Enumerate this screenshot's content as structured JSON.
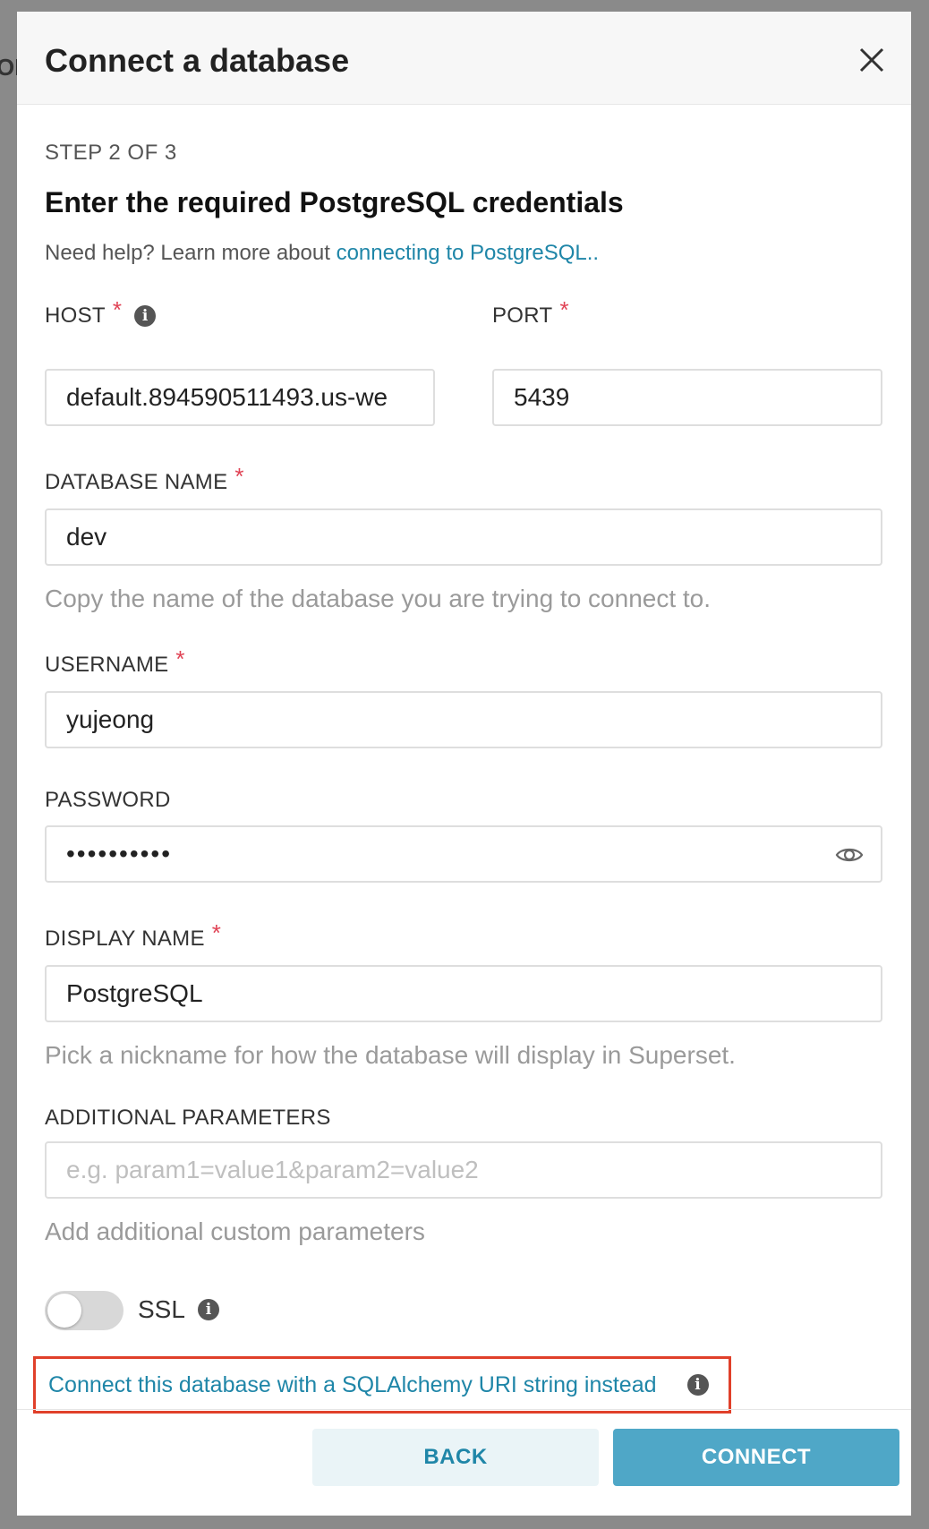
{
  "backdrop": {
    "text": "ON"
  },
  "modal": {
    "title": "Connect a database",
    "step": "STEP 2 OF 3",
    "heading": "Enter the required PostgreSQL credentials",
    "help_prefix": "Need help? Learn more about ",
    "help_link": "connecting to PostgreSQL.."
  },
  "form": {
    "host": {
      "label": "HOST",
      "required": "*",
      "value": "default.894590511493.us-we"
    },
    "port": {
      "label": "PORT",
      "required": "*",
      "value": "5439"
    },
    "database_name": {
      "label": "DATABASE NAME",
      "required": "*",
      "value": "dev",
      "hint": "Copy the name of the database you are trying to connect to."
    },
    "username": {
      "label": "USERNAME",
      "required": "*",
      "value": "yujeong"
    },
    "password": {
      "label": "PASSWORD",
      "value": "••••••••••"
    },
    "display_name": {
      "label": "DISPLAY NAME",
      "required": "*",
      "value": "PostgreSQL",
      "hint": "Pick a nickname for how the database will display in Superset."
    },
    "additional_parameters": {
      "label": "ADDITIONAL PARAMETERS",
      "placeholder": "e.g. param1=value1&param2=value2",
      "hint": "Add additional custom parameters"
    },
    "ssl": {
      "label": "SSL",
      "enabled": false
    }
  },
  "sqlalchemy_link": "Connect this database with a SQLAlchemy URI string instead",
  "footer": {
    "back_label": "BACK",
    "connect_label": "CONNECT"
  },
  "colors": {
    "accent": "#1f86a8",
    "primary_button": "#4fa7c7",
    "required": "#e04355",
    "highlight_box": "#e0402a"
  }
}
